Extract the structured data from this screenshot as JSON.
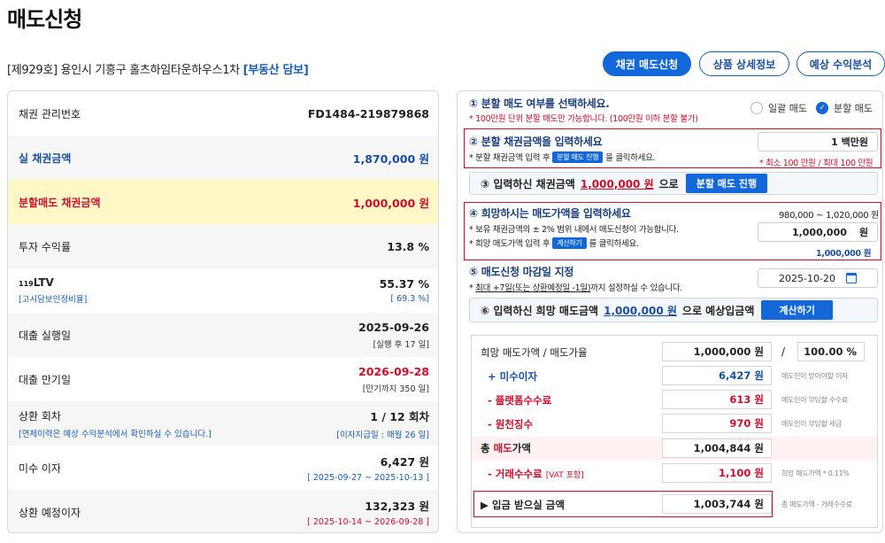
{
  "page": {
    "title": "매도신청",
    "product_code": "[제929호]",
    "product_name": "용인시 기흥구 홀츠하임타운하우스1차",
    "product_tag": "[부동산 담보]"
  },
  "top_buttons": {
    "bond_sell": "채권 매도신청",
    "product_detail": "상품 상세정보",
    "expected_return": "예상 수익분석"
  },
  "left": {
    "bond_no_label": "채권 관리번호",
    "bond_no_value": "FD1484-219879868",
    "real_amount_label": "실 채권금액",
    "real_amount_value": "1,870,000 원",
    "split_amount_label": "분할매도 채권금액",
    "split_amount_value": "1,000,000 원",
    "return_label": "투자 수익률",
    "return_value": "13.8 %",
    "ltv_prefix": "119",
    "ltv_label": "LTV",
    "ltv_sub_label": "[고시담보인정비율]",
    "ltv_value": "55.37 %",
    "ltv_sub_value": "[ 69.3 %]",
    "loan_exec_label": "대출 실행일",
    "loan_exec_value": "2025-09-26",
    "loan_exec_sub": "[실행 후 17 일]",
    "loan_mat_label": "대출 만기일",
    "loan_mat_value": "2026-09-28",
    "loan_mat_sub": "[만기까지 350 일]",
    "repay_label": "상환 회차",
    "repay_sub_label": "[연체이력은 예상 수익분석에서 확인하실 수 있습니다.]",
    "repay_value": "1 / 12 회차",
    "repay_sub_value": "[이자지급일 : 매월 26 일]",
    "unpaid_label": "미수 이자",
    "unpaid_value": "6,427 원",
    "unpaid_sub": "[ 2025-09-27 ~ 2025-10-13 ]",
    "planned_label": "상환 예정이자",
    "planned_value": "132,323 원",
    "planned_sub": "[ 2025-10-14 ~ 2026-09-28 ]"
  },
  "steps": {
    "s1_title": "① 분할 매도 여부를 선택하세요.",
    "s1_note": "* 100만원 단위 분할 매도만 가능합니다. (100만원 이하 분할 불가)",
    "s1_opt_full": "일괄 매도",
    "s1_opt_split": "분할 매도",
    "s1_check": "✓",
    "s2_title": "② 분할 채권금액을 입력하세요",
    "s2_note_a": "* 분할 채권금액 입력 후",
    "s2_chip": "분할 매도 진행",
    "s2_note_b": "을 클릭하세요.",
    "s2_input": "1 백만원",
    "s2_limit": "* 최소 100 만원 / 최대 100 만원",
    "s3_text_a": "③ 입력하신 채권금액",
    "s3_amount": "1,000,000 원",
    "s3_text_b": "으로",
    "s3_button": "분할 매도 진행",
    "s4_title": "④ 희망하시는 매도가액을 입력하세요",
    "s4_range": "980,000 ~ 1,020,000 원",
    "s4_note1": "* 보유 채권금액의 ± 2% 범위 내에서 매도신청이 가능합니다.",
    "s4_note2_a": "* 희망 매도가액 입력 후",
    "s4_chip": "계산하기",
    "s4_note2_b": "를 클릭하세요.",
    "s4_input": "1,000,000",
    "s4_unit": "원",
    "s4_echo": "1,000,000 원",
    "s5_title": "⑤ 매도신청 마감일 지정",
    "s5_note_a": "* ",
    "s5_note_u": "최대 +7일(또는 상환예정일 -1일)",
    "s5_note_b": "까지 설정하실 수 있습니다.",
    "s5_date": "2025-10-20",
    "s6_text_a": "⑥ 입력하신 희망 매도금액",
    "s6_amount": "1,000,000 원",
    "s6_text_b": "으로 예상입금액",
    "s6_button": "계산하기"
  },
  "summary": {
    "hope_label": "희망 매도가액 / 매도가율",
    "hope_value": "1,000,000 원",
    "slash": "/",
    "hope_rate": "100.00 %",
    "unpaid_label": "+   미수이자",
    "unpaid_value": "6,427 원",
    "unpaid_hint": "매도인이 받아야할 이자",
    "platform_label": "-   플랫폼수수료",
    "platform_value": "613 원",
    "platform_hint": "매도인이 부담할 수수료",
    "tax_label": "-   원천징수",
    "tax_value": "970 원",
    "tax_hint": "매도인이 부담할 세금",
    "total_label_a": "총 ",
    "total_label_b": "매도",
    "total_label_c": "가액",
    "total_value": "1,004,844 원",
    "fee_label": "-   거래수수료",
    "fee_vat": "[VAT 포함]",
    "fee_value": "1,100 원",
    "fee_hint": "희망 매도가액 * 0.11%",
    "receive_label": "▶ 입금 받으실 금액",
    "receive_value": "1,003,744 원",
    "receive_hint": "총 매도가액 - 거래수수료"
  },
  "colors": {
    "primary": "#1467d8",
    "navy": "#1a4fa0",
    "red": "#c8102e",
    "highlight": "#fff7c6"
  },
  "icons": {
    "calendar": "calendar-icon",
    "check": "check-icon"
  }
}
